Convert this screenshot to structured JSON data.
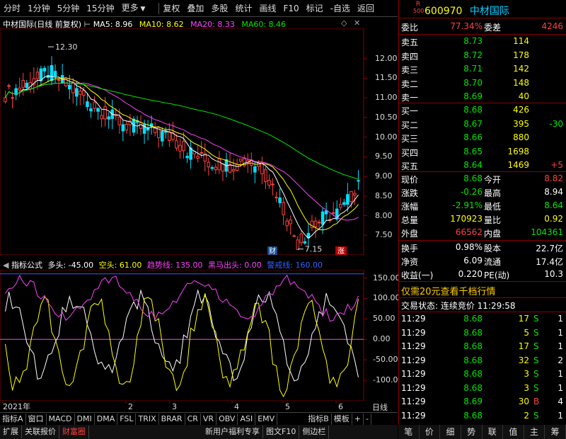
{
  "toolbar": {
    "items": [
      "分时",
      "1分钟",
      "5分钟",
      "15分钟",
      "更多",
      "复权",
      "叠加",
      "多股",
      "统计",
      "画线",
      "F10",
      "标记",
      "-自选",
      "返回"
    ]
  },
  "chart": {
    "title_name": "中材国际(日线 前复权)",
    "ma5": "MA5: 8.96",
    "ma10": "MA10: 8.62",
    "ma20": "MA20: 8.33",
    "ma60": "MA60: 8.46",
    "high_marker": "12.30",
    "low_marker": "7.15",
    "cai_badge": "财",
    "zhang_badge": "涨"
  },
  "chart_data": {
    "type": "line",
    "title": "中材国际(日线 前复权)",
    "yticks": [
      "12.00",
      "11.50",
      "11.00",
      "10.50",
      "10.00",
      "9.50",
      "9.00",
      "8.50",
      "8.00",
      "7.50"
    ],
    "ylim": [
      7.0,
      12.5
    ],
    "x_labels": [
      "2021年",
      "2",
      "3",
      "4",
      "5",
      "6"
    ],
    "indicator_yticks": [
      "150.00",
      "100.00",
      "50.00",
      "0.00",
      "-50.00",
      "-100.00"
    ],
    "indicator_ylim": [
      -150,
      170
    ]
  },
  "indicator": {
    "name": "指标公式",
    "duotou": "多头: -45.00",
    "kongtou": "空头: 61.00",
    "qushi": "趋势线: 135.00",
    "heima": "黑马出头: 0.00",
    "jingjie": "警戒线: 160.00"
  },
  "axis_label": "日线",
  "stock": {
    "code": "600970",
    "name": "中材国际",
    "r_badge": "R",
    "r_num": "500"
  },
  "order_book": {
    "weibi_label": "委比",
    "weibi": "77.34%",
    "weicha_label": "委差",
    "weicha": "4246",
    "asks": [
      {
        "label": "卖五",
        "price": "8.73",
        "vol": "114",
        "chg": ""
      },
      {
        "label": "卖四",
        "price": "8.72",
        "vol": "178",
        "chg": ""
      },
      {
        "label": "卖三",
        "price": "8.71",
        "vol": "142",
        "chg": ""
      },
      {
        "label": "卖二",
        "price": "8.70",
        "vol": "148",
        "chg": ""
      },
      {
        "label": "卖一",
        "price": "8.69",
        "vol": "40",
        "chg": ""
      }
    ],
    "bids": [
      {
        "label": "买一",
        "price": "8.68",
        "vol": "426",
        "chg": ""
      },
      {
        "label": "买二",
        "price": "8.67",
        "vol": "395",
        "chg": "-30"
      },
      {
        "label": "买三",
        "price": "8.66",
        "vol": "880",
        "chg": ""
      },
      {
        "label": "买四",
        "price": "8.65",
        "vol": "1698",
        "chg": ""
      },
      {
        "label": "买五",
        "price": "8.64",
        "vol": "1469",
        "chg": "+5"
      }
    ]
  },
  "quote": {
    "rows": [
      {
        "l1": "现价",
        "v1": "8.68",
        "l2": "今开",
        "v2": "8.82"
      },
      {
        "l1": "涨跌",
        "v1": "-0.26",
        "l2": "最高",
        "v2": "8.94"
      },
      {
        "l1": "涨幅",
        "v1": "-2.91%",
        "l2": "最低",
        "v2": "8.64"
      },
      {
        "l1": "总量",
        "v1": "170923",
        "l2": "量比",
        "v2": "0.92"
      },
      {
        "l1": "外盘",
        "v1": "66562",
        "l2": "内盘",
        "v2": "104361"
      }
    ],
    "rows2": [
      {
        "l1": "换手",
        "v1": "0.98%",
        "l2": "股本",
        "v2": "22.7亿"
      },
      {
        "l1": "净资",
        "v1": "6.09",
        "l2": "流通",
        "v2": "17.4亿"
      },
      {
        "l1": "收益(一)",
        "v1": "0.220",
        "l2": "PE(动)",
        "v2": "10.3"
      }
    ]
  },
  "promo": "仅需20元查看千档行情",
  "trade_status": "交易状态: 连续竞价 11:29:58",
  "ticks": [
    {
      "t": "11:29",
      "p": "8.68",
      "v": "17",
      "s": "S",
      "n": "1"
    },
    {
      "t": "11:29",
      "p": "8.68",
      "v": "5",
      "s": "S",
      "n": "1"
    },
    {
      "t": "11:29",
      "p": "8.68",
      "v": "17",
      "s": "S",
      "n": "1"
    },
    {
      "t": "11:29",
      "p": "8.68",
      "v": "32",
      "s": "S",
      "n": "2"
    },
    {
      "t": "11:29",
      "p": "8.68",
      "v": "3",
      "s": "S",
      "n": "1"
    },
    {
      "t": "11:29",
      "p": "8.68",
      "v": "3",
      "s": "S",
      "n": "1"
    },
    {
      "t": "11:29",
      "p": "8.69",
      "v": "30",
      "s": "B",
      "n": "4"
    },
    {
      "t": "11:29",
      "p": "8.68",
      "v": "2",
      "s": "S",
      "n": "1"
    }
  ],
  "bottom_tabs1": [
    "指标A",
    "窗口",
    "MACD",
    "DMI",
    "DMA",
    "FSL",
    "TRIX",
    "BRAR",
    "CR",
    "VR",
    "OBV",
    "ASI",
    "EMV",
    "指标B",
    "模板",
    "+",
    "-"
  ],
  "bottom_tabs2": [
    "扩展",
    "关联报价",
    "财富圈",
    "新用户福利专享",
    "图文F10",
    "侧边栏"
  ],
  "right_tabs": [
    "笔",
    "价",
    "细",
    "势",
    "联",
    "值",
    "主",
    "筹"
  ],
  "colors": {
    "up": "#ff4040",
    "down": "#00e600",
    "ma5": "#ffffff",
    "ma10": "#ffff00",
    "ma20": "#ff40ff",
    "ma60": "#00e600"
  }
}
